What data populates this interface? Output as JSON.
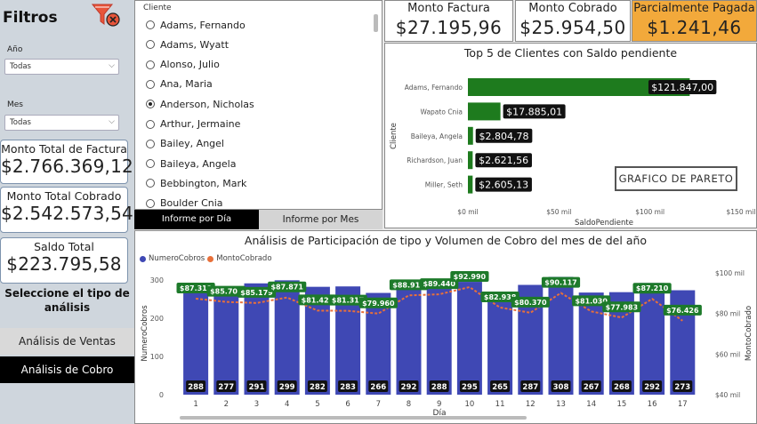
{
  "filters": {
    "title": "Filtros",
    "year_label": "Año",
    "year_value": "Todas",
    "month_label": "Mes",
    "month_value": "Todas"
  },
  "left_kpis": [
    {
      "label": "Monto Total de Factura",
      "value": "$2.766.369,12"
    },
    {
      "label": "Monto Total Cobrado",
      "value": "$2.542.573,54"
    },
    {
      "label": "Saldo Total",
      "value": "$223.795,58"
    }
  ],
  "analysis": {
    "prompt": "Seleccione el tipo de análisis",
    "sales_button": "Análisis de Ventas",
    "collection_button": "Análisis de Cobro"
  },
  "client_slicer": {
    "header": "Cliente",
    "items": [
      {
        "name": "Adams, Fernando",
        "selected": false
      },
      {
        "name": "Adams, Wyatt",
        "selected": false
      },
      {
        "name": "Alonso, Julio",
        "selected": false
      },
      {
        "name": "Ana, Maria",
        "selected": false
      },
      {
        "name": "Anderson, Nicholas",
        "selected": true
      },
      {
        "name": "Arthur, Jermaine",
        "selected": false
      },
      {
        "name": "Bailey, Angel",
        "selected": false
      },
      {
        "name": "Baileya, Angela",
        "selected": false
      },
      {
        "name": "Bebbington, Mark",
        "selected": false
      },
      {
        "name": "Boulder Cnia",
        "selected": false
      }
    ]
  },
  "report_tabs": {
    "day": "Informe por Día",
    "month": "Informe por Mes"
  },
  "top_kpis": [
    {
      "label": "Monto Factura",
      "value": "$27.195,96"
    },
    {
      "label": "Monto Cobrado",
      "value": "$25.954,50"
    },
    {
      "label": "Parcialmente Pagada",
      "value": "$1.241,46"
    }
  ],
  "colors": {
    "bar_green": "#1e7b1e",
    "bar_blue": "#3f48b4",
    "line_orange": "#e8703a",
    "label_green": "#1d7a2a",
    "kpi_orange": "#f2a93b"
  },
  "pareto_button": "GRAFICO DE PARETO",
  "chart_data": [
    {
      "type": "bar",
      "orientation": "horizontal",
      "title": "Top 5 de Clientes con Saldo pendiente",
      "ylabel": "Cliente",
      "xlabel": "SaldoPendiente",
      "categories": [
        "Adams, Fernando",
        "Wapato Cnia",
        "Baileya, Angela",
        "Richardson, Juan",
        "Miller, Seth"
      ],
      "values": [
        121847.0,
        17885.01,
        2804.78,
        2621.56,
        2605.13
      ],
      "data_labels": [
        "$121.847,00",
        "$17.885,01",
        "$2.804,78",
        "$2.621,56",
        "$2.605,13"
      ],
      "xticks": [
        "$0 mil",
        "$50 mil",
        "$100 mil",
        "$150 mil"
      ],
      "xlim": [
        0,
        150000
      ]
    },
    {
      "type": "bar",
      "title": "Análisis de Participación de tipo y Volumen de Cobro del mes de del año",
      "xlabel": "Día",
      "ylabel": "NumeroCobros",
      "y2label": "MontoCobrado",
      "legend": [
        "NumeroCobros",
        "MontoCobrado"
      ],
      "legend_position": "top-left",
      "categories": [
        "1",
        "2",
        "3",
        "4",
        "5",
        "6",
        "7",
        "8",
        "9",
        "10",
        "11",
        "12",
        "13",
        "14",
        "15",
        "16",
        "17"
      ],
      "series": [
        {
          "name": "NumeroCobros",
          "type": "bar",
          "values": [
            288,
            277,
            291,
            299,
            282,
            283,
            266,
            292,
            288,
            295,
            265,
            287,
            308,
            267,
            268,
            292,
            273
          ]
        },
        {
          "name": "MontoCobrado",
          "type": "line",
          "values": [
            87311,
            85707,
            85179,
            87871,
            81427,
            81317,
            79960,
            88913,
            89440,
            92990,
            82938,
            80370,
            90117,
            81030,
            77983,
            87210,
            76426
          ],
          "labels": [
            "$87.311",
            "$85.707",
            "$85.179",
            "$87.871",
            "$81.427",
            "$81.317",
            "$79.960",
            "$88.913",
            "$89.440",
            "$92.990",
            "$82.938",
            "$80.370",
            "$90.117",
            "$81.030",
            "$77.983",
            "$87.210",
            "$76.426"
          ]
        }
      ],
      "yticks": [
        "0",
        "100",
        "200",
        "300"
      ],
      "ylim": [
        0,
        330
      ],
      "y2ticks": [
        "$40 mil",
        "$60 mil",
        "$80 mil",
        "$100 mil"
      ],
      "y2lim": [
        40000,
        100000
      ]
    }
  ]
}
